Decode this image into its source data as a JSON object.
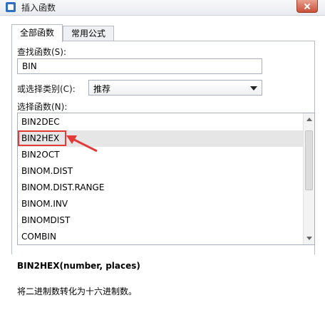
{
  "window": {
    "title": "插入函数"
  },
  "tabs": [
    {
      "label": "全部函数",
      "active": true
    },
    {
      "label": "常用公式",
      "active": false
    }
  ],
  "search": {
    "label": "查找函数(S):",
    "value": "BIN"
  },
  "category": {
    "label": "或选择类别(C):",
    "value": "推荐"
  },
  "function_list": {
    "label": "选择函数(N):",
    "items": [
      "BIN2DEC",
      "BIN2HEX",
      "BIN2OCT",
      "BINOM.DIST",
      "BINOM.DIST.RANGE",
      "BINOM.INV",
      "BINOMDIST",
      "COMBIN"
    ],
    "selected_index": 1
  },
  "selected_function": {
    "signature": "BIN2HEX(number, places)",
    "description": "将二进制数转化为十六进制数。"
  },
  "colors": {
    "highlight": "#e53935",
    "selected_row": "#e6e6e6",
    "title_bar": "#eef0f3"
  }
}
